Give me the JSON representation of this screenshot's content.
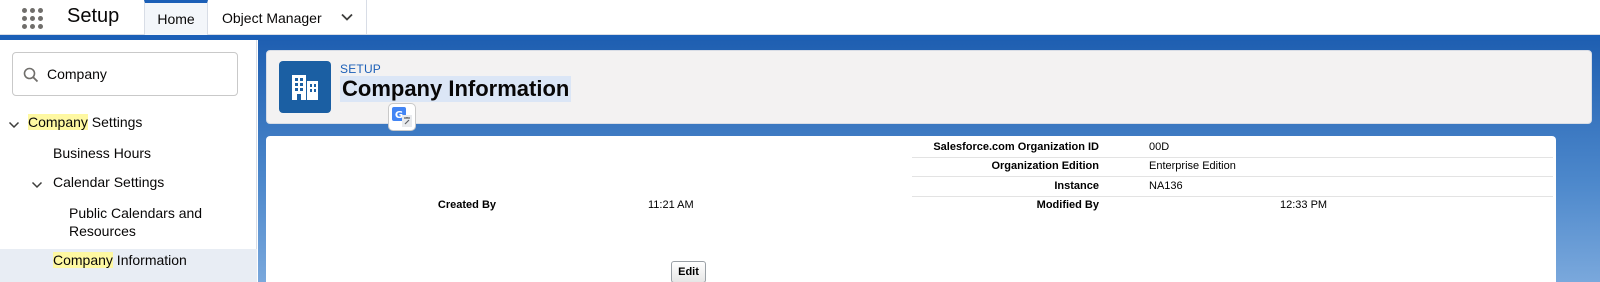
{
  "topbar": {
    "app_title": "Setup",
    "tabs": [
      {
        "label": "Home"
      },
      {
        "label": "Object Manager"
      }
    ]
  },
  "sidebar": {
    "search": {
      "value": "Company"
    },
    "tree": [
      {
        "prefix": "Company",
        "suffix": " Settings"
      },
      {
        "label": "Business Hours"
      },
      {
        "label": "Calendar Settings"
      },
      {
        "label_line1": "Public Calendars and",
        "label_line2": "Resources"
      },
      {
        "prefix": "Company",
        "suffix": " Information"
      }
    ]
  },
  "header": {
    "eyebrow": "SETUP",
    "title": "Company Information"
  },
  "details": {
    "org_id_label": "Salesforce.com Organization ID",
    "org_id_value": "00D",
    "edition_label": "Organization Edition",
    "edition_value": "Enterprise Edition",
    "instance_label": "Instance",
    "instance_value": "NA136",
    "created_by_label": "Created By",
    "created_by_time": "11:21 AM",
    "modified_by_label": "Modified By",
    "modified_by_time": "12:33 PM",
    "edit_button": "Edit"
  },
  "icons": {
    "app_launcher": "waffle-icon",
    "search": "search-icon",
    "header": "building-icon",
    "translate": "google-translate-icon"
  },
  "colors": {
    "brand_blue": "#1b5fb7",
    "highlight": "#fef8a2"
  }
}
